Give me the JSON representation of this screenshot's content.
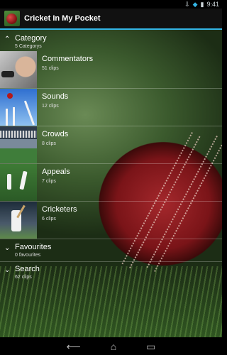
{
  "status_bar": {
    "time": "9:41",
    "icons": [
      "download-icon",
      "wifi-icon",
      "battery-icon"
    ]
  },
  "app_bar": {
    "title": "Cricket In My Pocket",
    "icon": "cricket-ball-icon"
  },
  "category": {
    "title": "Category",
    "subtitle": "5 Categorys",
    "items": [
      {
        "label": "Commentators",
        "count": "51 clips"
      },
      {
        "label": "Sounds",
        "count": "12 clips"
      },
      {
        "label": "Crowds",
        "count": "8 clips"
      },
      {
        "label": "Appeals",
        "count": "7 clips"
      },
      {
        "label": "Cricketers",
        "count": "6 clips"
      }
    ]
  },
  "favourites": {
    "title": "Favourites",
    "subtitle": "0 favourites"
  },
  "search": {
    "title": "Search",
    "subtitle": "62 clips"
  },
  "nav": {
    "back_icon": "back-icon",
    "home_icon": "home-icon",
    "recents_icon": "recent-apps-icon"
  },
  "colors": {
    "accent": "#33b5e5",
    "ball_red": "#8b1a1f",
    "grass_green": "#3b5a2d"
  }
}
